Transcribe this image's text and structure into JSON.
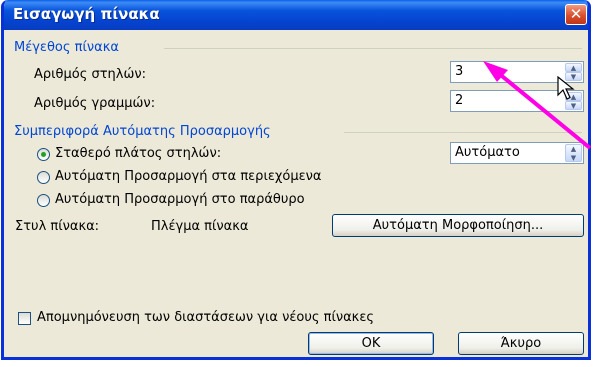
{
  "dialog": {
    "title": "Εισαγωγή πίνακα",
    "close_label": "✕"
  },
  "size_group": {
    "label": "Μέγεθος πίνακα",
    "columns_label": "Αριθμός στηλών:",
    "columns_value": "3",
    "rows_label": "Αριθμός γραμμών:",
    "rows_value": "2"
  },
  "autofit_group": {
    "label": "Συμπεριφορά Αυτόματης Προσαρμογής",
    "options": [
      {
        "label": "Σταθερό πλάτος στηλών:",
        "selected": true
      },
      {
        "label": "Αυτόματη Προσαρμογή στα περιεχόμενα",
        "selected": false
      },
      {
        "label": "Αυτόματη Προσαρμογή στο παράθυρο",
        "selected": false
      }
    ],
    "fixed_width_value": "Αυτόματο"
  },
  "table_style": {
    "label": "Στυλ πίνακα:",
    "value": "Πλέγμα πίνακα",
    "autoformat_button": "Αυτόματη Μορφοποίηση..."
  },
  "remember": {
    "label": "Απομνημόνευση των διαστάσεων για νέους πίνακες",
    "checked": false
  },
  "buttons": {
    "ok": "OK",
    "cancel": "Άκυρο"
  },
  "annotation": {
    "color": "#ff00e6"
  }
}
